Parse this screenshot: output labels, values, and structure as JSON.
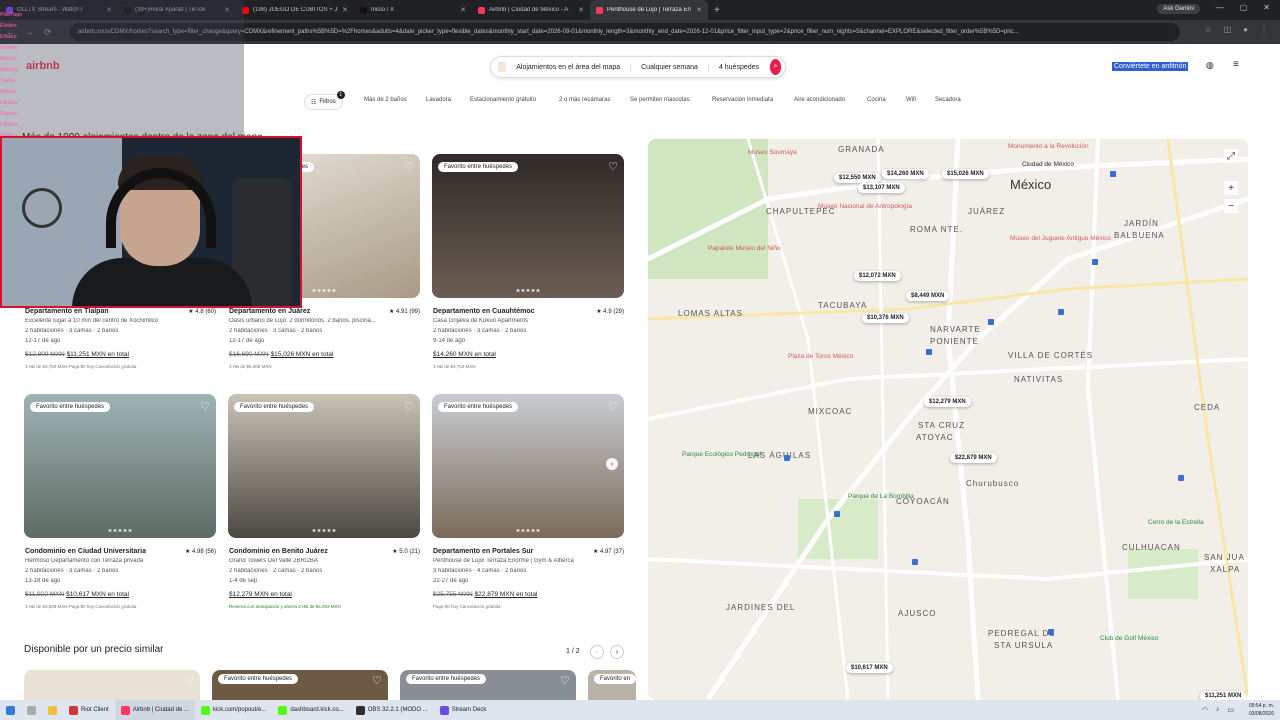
{
  "browser": {
    "tabs": [
      {
        "label": "OLLTX Stream - Watch I",
        "color": "#9146ff"
      },
      {
        "label": "(39+)#viral #parati | TikTok",
        "color": "#111111"
      },
      {
        "label": "(198) JUEGO DE CUBITOS + JUE",
        "color": "#ff0000"
      },
      {
        "label": "Inicio / X",
        "color": "#111111"
      },
      {
        "label": "Airbnb | Ciudad de México - A",
        "color": "#ff385c"
      },
      {
        "label": "Penthouse de Lujo | Terraza En",
        "color": "#ff385c"
      }
    ],
    "gemini": "Ask Gemini",
    "url": "airbnb.mx/s/CDMX/homes?search_type=filter_change&query=CDMX&refinement_paths%5B%5D=%2Fhomes&adults=4&date_picker_type=flexible_dates&monthly_start_date=2026-09-01&monthly_length=3&monthly_end_date=2026-12-01&price_filter_input_type=2&price_filter_num_nights=5&channel=EXPLORE&selected_filter_order%5B%5D=pric..."
  },
  "overlay": {
    "lines": [
      "PikaTiago",
      "Elfakire",
      "Elfakire",
      "Gedhite",
      "Elfakire",
      "Alfaking",
      "Tvaflre",
      "Allialan",
      "Ultralive",
      "Ellaalre",
      "Ulfalires",
      "Elfaalcs",
      "Ulfalires"
    ],
    "title_fragment": "Más de 1000 alojamientos dentro de la zona del mapa"
  },
  "header": {
    "logo": "airbnb",
    "search_where": "Alojamientos en el área del mapa",
    "search_when": "Cualquier semana",
    "search_who": "4 huéspedes",
    "host_link": "Conviértete en anfitrión"
  },
  "filters": {
    "filters_label": "Filtros",
    "badge": "1",
    "chips": [
      "Más de 2 baños",
      "Lavadora",
      "Estacionamiento gratuito",
      "2 o más recámaras",
      "Se permiten mascotas",
      "Reservación inmediata",
      "Aire acondicionado",
      "Cocina",
      "Wifi",
      "Secadora"
    ]
  },
  "listings": [
    {
      "badge": "",
      "title": "Departamento en Tlalpan",
      "rating": "★ 4.8 (60)",
      "desc": "Excelente lugar a 10 min del centro de Xochimilco",
      "beds": "2 habitaciones · 3 camas · 2 baños",
      "dates": "12-17 de ago",
      "old_price": "$12,809 MXN",
      "new_price": "$11,251 MXN en total",
      "fine": "3 HB de $3,750 MXN   Paga $0 hoy   Cancelación gratuita",
      "photo": [
        "#d9d3c8",
        "#b9ae9c"
      ]
    },
    {
      "badge": "Favorito entre huéspedes",
      "title": "Departamento en Juárez",
      "rating": "★ 4.91 (99)",
      "desc": "Oasis urbano de Lujo: 2 dormitorios, 2 baños, piscina...",
      "beds": "2 habitaciones · 3 camas · 2 baños",
      "dates": "12-17 de ago",
      "old_price": "$16,690 MXN",
      "new_price": "$15,026 MXN en total",
      "fine": "3 HB de $5,009 MXN",
      "photo": [
        "#e7e2d8",
        "#a89a86"
      ]
    },
    {
      "badge": "Favorito entre huéspedes",
      "title": "Departamento en Cuauhtémoc",
      "rating": "★ 4.9 (29)",
      "desc": "Casa Grijalva de Kukun Apartments",
      "beds": "2 habitaciones · 3 camas · 2 baños",
      "dates": "9-14 de ago",
      "old_price": "",
      "new_price": "$14,260 MXN en total",
      "fine": "3 HB de $4,753 MXN",
      "photo": [
        "#3a3330",
        "#6b5d52"
      ]
    },
    {
      "badge": "Favorito entre huéspedes",
      "title": "Condominio en Ciudad Universitaria",
      "rating": "★ 4.98 (56)",
      "desc": "Hermoso Departamento con Terraza privada",
      "beds": "2 habitaciones · 3 camas · 2 baños",
      "dates": "13-18 de ago",
      "old_price": "$11,922 MXN",
      "new_price": "$10,617 MXN en total",
      "fine": "3 HB de $3,539 MXN   Paga $0 hoy   Cancelación gratuita",
      "photo": [
        "#9fb3b5",
        "#5d6b62"
      ]
    },
    {
      "badge": "Favorito entre huéspedes",
      "title": "Condominio en Benito Juárez",
      "rating": "★ 5.0 (21)",
      "desc": "Grand Towers Del Valle 2BR/2BA",
      "beds": "2 habitaciones · 2 camas · 2 baños",
      "dates": "1-4 de sep",
      "old_price": "",
      "new_price": "$12,279 MXN en total",
      "fine": "Reserva con anticipación y ahorra   3 HB de $4,093 MXN",
      "photo": [
        "#c9c3b6",
        "#4b4842"
      ]
    },
    {
      "badge": "Favorito entre huéspedes",
      "title": "Departamento en Portales Sur",
      "rating": "★ 4.97 (37)",
      "desc": "Penthouse de Lujo! Terraza Enorme | Gym & Alberca",
      "beds": "3 habitaciones · 4 camas · 2 baños",
      "dates": "22-27 de ago",
      "old_price": "$25,755 MXN",
      "new_price": "$22,879 MXN en total",
      "fine": "Paga $0 hoy   Cancelación gratuita",
      "photo": [
        "#c8cdd2",
        "#7b6a58"
      ]
    }
  ],
  "similar": {
    "title": "Disponible por un precio similar",
    "page": "1 / 2",
    "badges": [
      "",
      "Favorito entre huéspedes",
      "Favorito entre huéspedes",
      "Favorito en"
    ]
  },
  "map": {
    "labels": [
      {
        "t": "GRANADA",
        "k": "normal"
      },
      {
        "t": "México",
        "k": "big"
      },
      {
        "t": "CHAPULTEPEC",
        "k": "normal"
      },
      {
        "t": "ROMA NTE.",
        "k": "normal"
      },
      {
        "t": "JUÁREZ",
        "k": "normal"
      },
      {
        "t": "TACUBAYA",
        "k": "normal"
      },
      {
        "t": "NARVARTE",
        "k": "normal"
      },
      {
        "t": "PONIENTE",
        "k": "normal"
      },
      {
        "t": "VILLA DE CORTÉS",
        "k": "normal"
      },
      {
        "t": "LOMAS ALTAS",
        "k": "normal"
      },
      {
        "t": "NATIVITAS",
        "k": "normal"
      },
      {
        "t": "MIXCOAC",
        "k": "normal"
      },
      {
        "t": "STA CRUZ",
        "k": "normal"
      },
      {
        "t": "ATOYAC",
        "k": "normal"
      },
      {
        "t": "CEDA",
        "k": "normal"
      },
      {
        "t": "LAS ÁGUILAS",
        "k": "normal"
      },
      {
        "t": "Churubusco",
        "k": "normal"
      },
      {
        "t": "COYOACÁN",
        "k": "normal"
      },
      {
        "t": "CULHUACAN",
        "k": "normal"
      },
      {
        "t": "JARDINES DEL",
        "k": "normal"
      },
      {
        "t": "AJUSCO",
        "k": "normal"
      },
      {
        "t": "PEDREGAL DE",
        "k": "normal"
      },
      {
        "t": "STA URSULA",
        "k": "normal"
      },
      {
        "t": "SAN JUA",
        "k": "normal"
      },
      {
        "t": "XALPA",
        "k": "normal"
      },
      {
        "t": "BALBUENA",
        "k": "normal"
      },
      {
        "t": "JARDÍN",
        "k": "normal"
      },
      {
        "t": "Museo Soumaya",
        "k": "poi"
      },
      {
        "t": "Museo Nacional de Antropología",
        "k": "poi"
      },
      {
        "t": "Papalote Museo del Niño",
        "k": "poi"
      },
      {
        "t": "Museo del Juguete Antiguo México",
        "k": "poi"
      },
      {
        "t": "Monumento a la Revolución",
        "k": "poi"
      },
      {
        "t": "Plaza de Toros México",
        "k": "poi"
      },
      {
        "t": "Parque Ecológico Pedregal",
        "k": "park"
      },
      {
        "t": "Parque de La Bombilla",
        "k": "park"
      },
      {
        "t": "Club de Golf México",
        "k": "park"
      },
      {
        "t": "Cerro de la Estrella",
        "k": "park"
      },
      {
        "t": "Ciudad de México",
        "k": "poi"
      }
    ],
    "prices": [
      "$12,550 MXN",
      "$14,260 MXN",
      "$13,107 MXN",
      "$15,026 MXN",
      "$12,072 MXN",
      "$8,449 MXN",
      "$10,376 MXN",
      "$12,279 MXN",
      "$22,879 MXN",
      "$10,617 MXN",
      "$11,251 MXN"
    ]
  },
  "taskbar": {
    "items": [
      {
        "label": "Riot Client",
        "color": "#d13639"
      },
      {
        "label": "Airbnb | Ciudad de ...",
        "color": "#ff385c"
      },
      {
        "label": "kick.com/popout/e...",
        "color": "#53fc18"
      },
      {
        "label": "dashboard.kick.co...",
        "color": "#53fc18"
      },
      {
        "label": "OBS 32.2.1 (MODO ...",
        "color": "#302e31"
      },
      {
        "label": "Stream Deck",
        "color": "#6b4ce6"
      }
    ],
    "time": "09:54 p. m.",
    "date": "03/08/2026"
  }
}
